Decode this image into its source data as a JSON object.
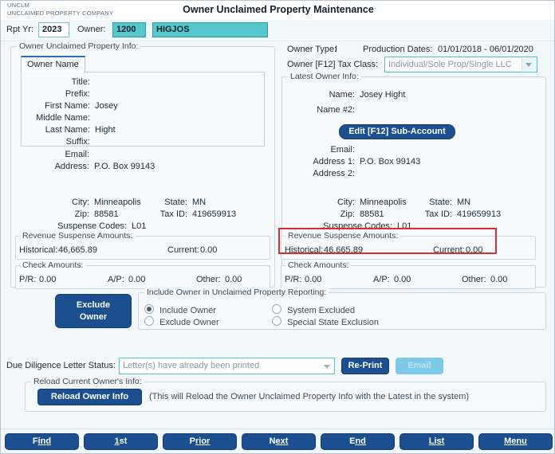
{
  "window": {
    "brand_code": "UNCLM",
    "brand_name": "UNCLAIMED PROPERTY COMPANY",
    "title": "Owner Unclaimed Property Maintenance"
  },
  "top_form": {
    "rpt_yr_label": "Rpt Yr:",
    "rpt_yr_value": "2023",
    "owner_label": "Owner:",
    "owner_number": "1200",
    "owner_id": "HIGJOS"
  },
  "left_panel": {
    "title": "Owner Unclaimed Property Info:",
    "tab_label": "Owner Name",
    "name_fields": [
      {
        "label": "Title:",
        "value": ""
      },
      {
        "label": "Prefix:",
        "value": ""
      },
      {
        "label": "First Name:",
        "value": "Josey"
      },
      {
        "label": "Middle Name:",
        "value": ""
      },
      {
        "label": "Last Name:",
        "value": "Hight"
      },
      {
        "label": "Suffix:",
        "value": ""
      }
    ],
    "email_label": "Email:",
    "email_value": "",
    "address_label": "Address:",
    "address_value": "P.O. Box 99143",
    "city_label": "City:",
    "city_value": "Minneapolis",
    "state_label": "State:",
    "state_value": "MN",
    "zip_label": "Zip:",
    "zip_value": "88581",
    "taxid_label": "Tax ID:",
    "taxid_value": "419659913",
    "suspense_codes_label": "Suspense Codes:",
    "suspense_codes_value": "L01",
    "revenue_group_title": "Revenue Suspense Amounts:",
    "historical_label": "Historical:",
    "historical_value": "46,665.89",
    "current_label": "Current:",
    "current_value": "0.00",
    "check_group_title": "Check Amounts:",
    "pr_label": "P/R:",
    "pr_value": "0.00",
    "ap_label": "A/P:",
    "ap_value": "0.00",
    "other_label": "Other:",
    "other_value": "0.00"
  },
  "right_panel": {
    "owner_type_label": "Owner Type:",
    "owner_type_value": "I",
    "production_dates_label": "Production Dates:",
    "production_dates_value": "01/01/2018 - 06/01/2020",
    "tax_class_label": "Owner [F12] Tax Class:",
    "tax_class_value": "Individual/Sole Prop/Single LLC",
    "title": "Latest Owner Info:",
    "name_label": "Name:",
    "name_value": "Josey Hight",
    "name2_label": "Name #2:",
    "name2_value": "",
    "edit_sub_account_label": "Edit [F12] Sub-Account",
    "email_label": "Email:",
    "email_value": "",
    "address1_label": "Address 1:",
    "address1_value": "P.O. Box 99143",
    "address2_label": "Address 2:",
    "address2_value": "",
    "city_label": "City:",
    "city_value": "Minneapolis",
    "state_label": "State:",
    "state_value": "MN",
    "zip_label": "Zip:",
    "zip_value": "88581",
    "taxid_label": "Tax ID:",
    "taxid_value": "419659913",
    "suspense_codes_label": "Suspense Codes:",
    "suspense_codes_value": "L01",
    "revenue_group_title": "Revenue Suspense Amounts:",
    "historical_label": "Historical:",
    "historical_value": "46,665.89",
    "current_label": "Current:",
    "current_value": "0.00",
    "check_group_title": "Check Amounts:",
    "pr_label": "P/R:",
    "pr_value": "0.00",
    "ap_label": "A/P:",
    "ap_value": "0.00",
    "other_label": "Other:",
    "other_value": "0.00"
  },
  "reporting": {
    "exclude_owner_button_line1": "Exclude",
    "exclude_owner_button_line2": "Owner",
    "group_title": "Include Owner in Unclaimed Property Reporting:",
    "options": [
      {
        "label": "Include Owner",
        "selected": true
      },
      {
        "label": "Exclude Owner",
        "selected": false
      },
      {
        "label": "System Excluded",
        "selected": false
      },
      {
        "label": "Special State Exclusion",
        "selected": false
      }
    ]
  },
  "due_diligence": {
    "label": "Due Diligence Letter Status:",
    "status_value": "Letter(s) have already been printed",
    "reprint_label": "Re-Print",
    "email_label": "Email"
  },
  "reload": {
    "group_title": "Reload Current Owner's Info:",
    "button_label": "Reload Owner Info",
    "note": "(This will Reload the Owner Unclaimed Property Info with the Latest in the system)"
  },
  "nav": {
    "buttons": [
      {
        "pre": "F",
        "key": "ind",
        "post": ""
      },
      {
        "pre": "",
        "key": "1",
        "post": "st"
      },
      {
        "pre": "P",
        "key": "rior",
        "post": ""
      },
      {
        "pre": "N",
        "key": "ext",
        "post": ""
      },
      {
        "pre": "E",
        "key": "nd",
        "post": ""
      },
      {
        "pre": "",
        "key": "List",
        "post": ""
      },
      {
        "pre": "",
        "key": "Menu",
        "post": ""
      }
    ]
  },
  "colors": {
    "accent_blue": "#1b4f8f",
    "teal_field": "#57c8cd",
    "highlight_red": "#e02b2b",
    "panel_bg": "#f2f7fb"
  }
}
